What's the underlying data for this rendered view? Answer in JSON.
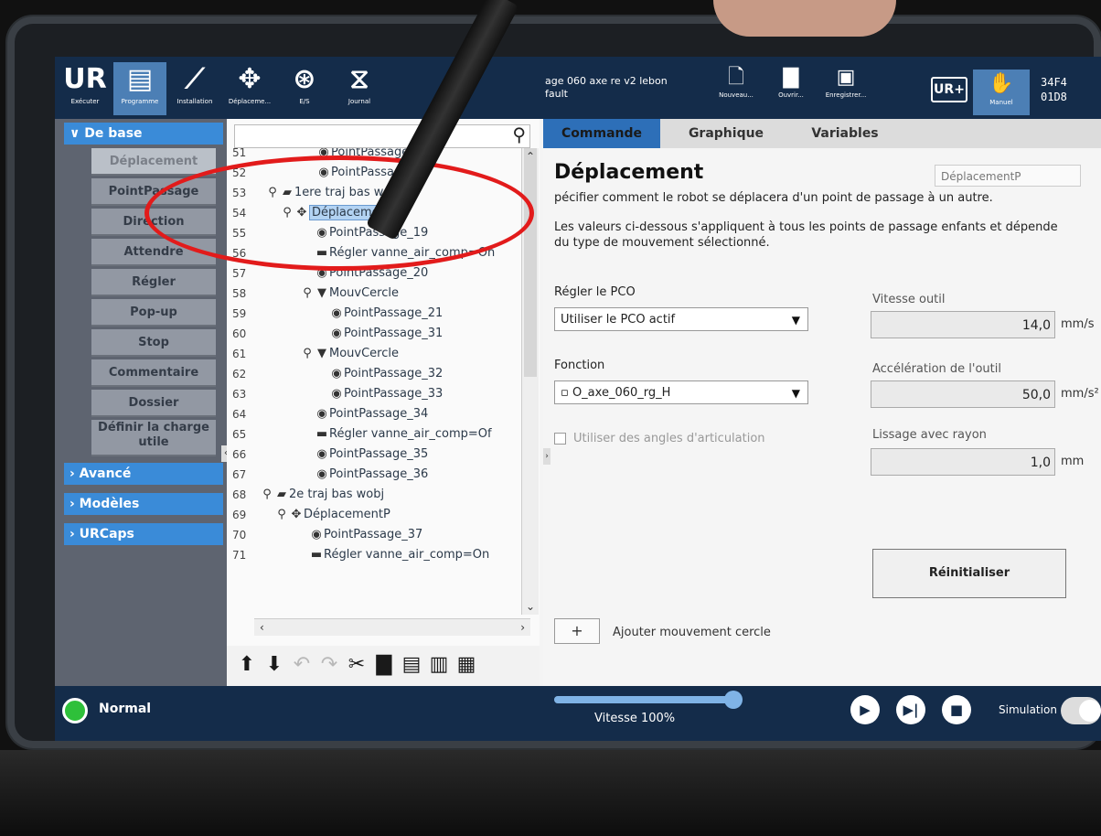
{
  "topbar": {
    "buttons": [
      {
        "label": "Exécuter",
        "icon": "ur-logo-icon"
      },
      {
        "label": "Programme",
        "icon": "program-icon"
      },
      {
        "label": "Installation",
        "icon": "installation-icon"
      },
      {
        "label": "Déplaceme...",
        "icon": "move-icon"
      },
      {
        "label": "E/S",
        "icon": "io-icon"
      },
      {
        "label": "Journal",
        "icon": "log-icon"
      }
    ],
    "program_name": "age 060 axe re v2 lebon",
    "program_sub": "fault",
    "file_buttons": [
      "Nouveau...",
      "Ouvrir...",
      "Enregistrer..."
    ],
    "urplus_label": "UR+",
    "mode_label": "Manuel",
    "id_line1": "34F4",
    "id_line2": "01D8"
  },
  "left_panel": {
    "basic_label": "De base",
    "commands": [
      "Déplacement",
      "PointPassage",
      "Direction",
      "Attendre",
      "Régler",
      "Pop-up",
      "Stop",
      "Commentaire",
      "Dossier",
      "Définir la charge utile"
    ],
    "advanced_label": "Avancé",
    "templates_label": "Modèles",
    "urcaps_label": "URCaps"
  },
  "tree": {
    "rows": [
      {
        "num": "51",
        "text": "PointPassage_o"
      },
      {
        "num": "52",
        "text": "PointPassage_6"
      },
      {
        "num": "53",
        "text": "1ere traj bas wobj"
      },
      {
        "num": "54",
        "text": "DéplacementP"
      },
      {
        "num": "55",
        "text": "PointPassage_19"
      },
      {
        "num": "56",
        "text": "Régler vanne_air_comp=On"
      },
      {
        "num": "57",
        "text": "PointPassage_20"
      },
      {
        "num": "58",
        "text": "MouvCercle"
      },
      {
        "num": "59",
        "text": "PointPassage_21"
      },
      {
        "num": "60",
        "text": "PointPassage_31"
      },
      {
        "num": "61",
        "text": "MouvCercle"
      },
      {
        "num": "62",
        "text": "PointPassage_32"
      },
      {
        "num": "63",
        "text": "PointPassage_33"
      },
      {
        "num": "64",
        "text": "PointPassage_34"
      },
      {
        "num": "65",
        "text": "Régler vanne_air_comp=Of"
      },
      {
        "num": "66",
        "text": "PointPassage_35"
      },
      {
        "num": "67",
        "text": "PointPassage_36"
      },
      {
        "num": "68",
        "text": "2e traj bas wobj"
      },
      {
        "num": "69",
        "text": "DéplacementP"
      },
      {
        "num": "70",
        "text": "PointPassage_37"
      },
      {
        "num": "71",
        "text": "Régler vanne_air_comp=On"
      }
    ]
  },
  "right_panel": {
    "tabs": [
      "Commande",
      "Graphique",
      "Variables"
    ],
    "title": "Déplacement",
    "node_name": "DéplacementP",
    "desc1": "pécifier comment le robot se déplacera d'un point de passage à un autre.",
    "desc2": "Les valeurs ci-dessous s'appliquent à tous les points de passage enfants et dépende",
    "desc3": "du type de mouvement sélectionné.",
    "tcp_label": "Régler le PCO",
    "tcp_value": "Utiliser le PCO actif",
    "feature_label": "Fonction",
    "feature_value": "O_axe_060_rg_H",
    "tool_speed_label": "Vitesse outil",
    "tool_speed_value": "14,0",
    "tool_speed_unit": "mm/s",
    "tool_accel_label": "Accélération de l'outil",
    "tool_accel_value": "50,0",
    "tool_accel_unit": "mm/s²",
    "blend_label": "Lissage avec rayon",
    "blend_value": "1,0",
    "blend_unit": "mm",
    "joint_angles_label": "Utiliser des angles d'articulation",
    "reset_label": "Réinitialiser",
    "add_circle_label": "Ajouter mouvement cercle"
  },
  "footer": {
    "status": "Normal",
    "speed_fraction": 1.0,
    "speed_label": "Vitesse 100%",
    "simulation_label": "Simulation"
  }
}
